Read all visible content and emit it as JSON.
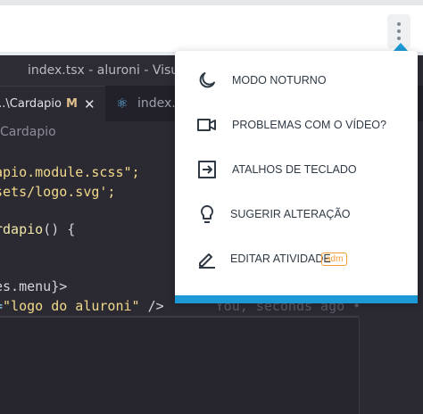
{
  "editor": {
    "window_title": "index.tsx - aluroni - Visual S",
    "tabs": [
      {
        "label": "...\\Cardapio",
        "modified": "M",
        "close": "✕"
      },
      {
        "label": "index.t"
      }
    ],
    "breadcrumb": "Cardapio",
    "code_lines": [
      {
        "a": "apio.module.scss",
        "q1": "\"",
        "end": "\";"
      },
      {
        "a": "sets/logo.svg",
        "end": "';"
      },
      {
        "fn": "rdapio",
        "rest": "() {"
      },
      {
        "rest": "es.menu}>"
      },
      {
        "attr": "=",
        "str": "\"logo do aluroni\"",
        "rest": " />",
        "ghost": "You, seconds ago •"
      }
    ]
  },
  "menu": {
    "items": [
      {
        "label": "MODO NOTURNO",
        "icon": "moon-icon"
      },
      {
        "label": "PROBLEMAS COM O VÍDEO?",
        "icon": "video-camera-icon"
      },
      {
        "label": "ATALHOS DE TECLADO",
        "icon": "keyboard-shortcut-icon"
      },
      {
        "label": "SUGERIR ALTERAÇÃO",
        "icon": "lightbulb-icon"
      },
      {
        "label": "EDITAR ATIVIDADE",
        "icon": "pencil-icon",
        "badge": "adm"
      }
    ]
  },
  "colors": {
    "accent": "#1d9ad6",
    "badge": "#f39c36",
    "menu_text": "#2f3a45",
    "editor_bg": "#2b2a33"
  }
}
